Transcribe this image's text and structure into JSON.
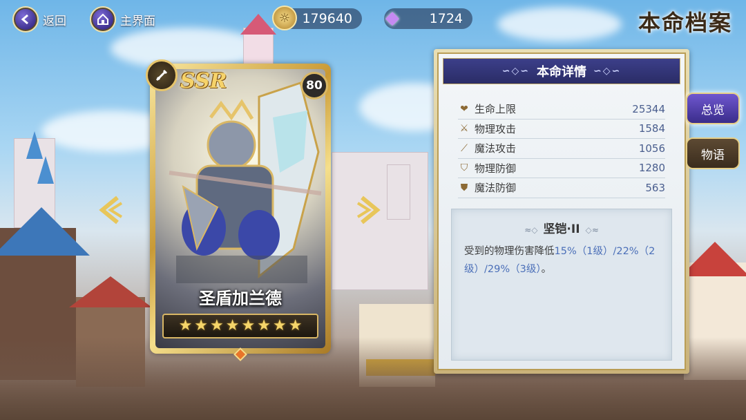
{
  "top": {
    "back_label": "返回",
    "home_label": "主界面",
    "gold_value": "179640",
    "gem_value": "1724",
    "page_title": "本命档案"
  },
  "card": {
    "rarity": "SSR",
    "level": "80",
    "name": "圣盾加兰德",
    "stars": 8
  },
  "panel": {
    "header": "本命详情",
    "stats": [
      {
        "icon": "heart-icon",
        "label": "生命上限",
        "value": "25344"
      },
      {
        "icon": "sword-icon",
        "label": "物理攻击",
        "value": "1584"
      },
      {
        "icon": "wand-icon",
        "label": "魔法攻击",
        "value": "1056"
      },
      {
        "icon": "shield-icon",
        "label": "物理防御",
        "value": "1280"
      },
      {
        "icon": "magic-shield-icon",
        "label": "魔法防御",
        "value": "563"
      }
    ],
    "skill": {
      "title": "坚铠·II",
      "desc_prefix": "受到的物理伤害降低",
      "desc_l1": "15%（1级）",
      "desc_sep1": "/",
      "desc_l2": "22%（2级）",
      "desc_sep2": "/",
      "desc_l3": "29%（3级）",
      "desc_suffix": "。"
    }
  },
  "tabs": {
    "overview": "总览",
    "story": "物语"
  },
  "colors": {
    "accent_purple": "#3a2d8a",
    "gold": "#d9b765",
    "stat_value": "#4a5e8e"
  }
}
